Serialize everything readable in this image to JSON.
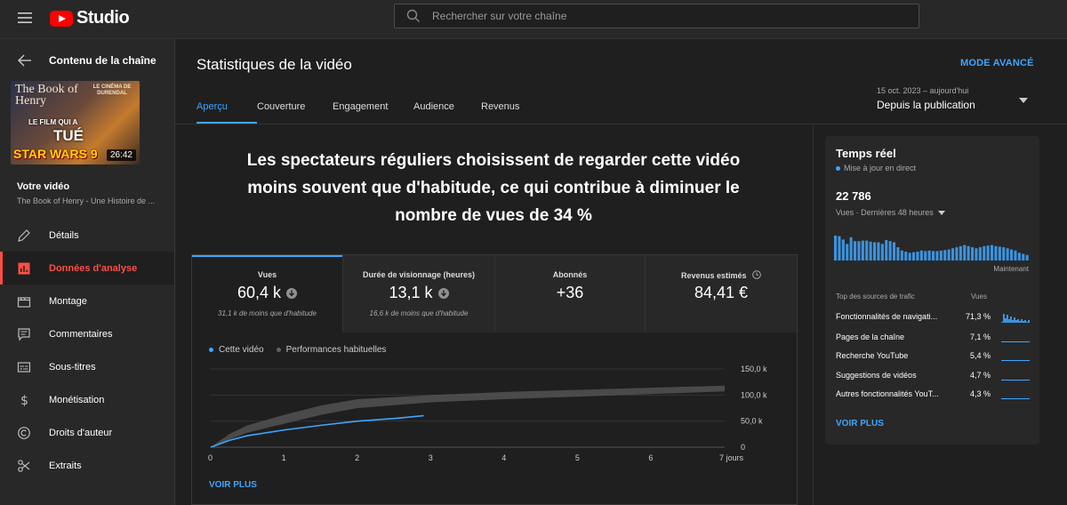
{
  "topbar": {
    "logo_text": "Studio",
    "search_placeholder": "Rechercher sur votre chaîne"
  },
  "sidebar": {
    "back_label": "Contenu de la chaîne",
    "thumbnail": {
      "text_line1": "The Book of Henry",
      "text_line2": "LE CINÉMA DE DURENDAL",
      "text_line3": "LE FILM QUI A",
      "text_line4": "TUÉ",
      "text_line5": "STAR WARS 9",
      "duration": "26:42"
    },
    "your_video_label": "Votre vidéo",
    "video_title": "The Book of Henry - Une Histoire de ...",
    "items": [
      {
        "label": "Détails",
        "icon": "pencil-icon"
      },
      {
        "label": "Données d'analyse",
        "icon": "analytics-icon",
        "active": true
      },
      {
        "label": "Montage",
        "icon": "clapper-icon"
      },
      {
        "label": "Commentaires",
        "icon": "comment-icon"
      },
      {
        "label": "Sous-titres",
        "icon": "subtitles-icon"
      },
      {
        "label": "Monétisation",
        "icon": "dollar-icon"
      },
      {
        "label": "Droits d'auteur",
        "icon": "copyright-icon"
      },
      {
        "label": "Extraits",
        "icon": "scissors-icon"
      }
    ]
  },
  "main": {
    "title": "Statistiques de la vidéo",
    "mode_button": "MODE AVANCÉ",
    "tabs": [
      "Aperçu",
      "Couverture",
      "Engagement",
      "Audience",
      "Revenus"
    ],
    "date_range": "15 oct. 2023 – aujourd'hui",
    "date_selection": "Depuis la publication",
    "headline": "Les spectateurs réguliers choisissent de regarder cette vidéo moins souvent que d'habitude, ce qui contribue à diminuer le nombre de vues de 34 %",
    "metrics": [
      {
        "label": "Vues",
        "value": "60,4 k",
        "sub": "31,1 k de moins que d'habitude",
        "trend": "down"
      },
      {
        "label": "Durée de visionnage (heures)",
        "value": "13,1 k",
        "sub": "16,6 k de moins que d'habitude",
        "trend": "down"
      },
      {
        "label": "Abonnés",
        "value": "+36",
        "sub": ""
      },
      {
        "label": "Revenus estimés",
        "value": "84,41 €",
        "sub": ""
      }
    ],
    "legend": [
      "Cette vidéo",
      "Performances habituelles"
    ],
    "see_more": "VOIR PLUS"
  },
  "chart_data": {
    "type": "line",
    "x_ticks": [
      "0",
      "1",
      "2",
      "3",
      "4",
      "5",
      "6",
      "7 jours"
    ],
    "y_ticks": [
      "0",
      "50,0 k",
      "100,0 k",
      "150,0 k"
    ],
    "ylim": [
      0,
      150000
    ],
    "xlim": [
      0,
      7
    ],
    "series": [
      {
        "name": "Cette vidéo",
        "color": "#3ea6ff",
        "x": [
          0,
          0.25,
          0.5,
          1,
          1.5,
          2,
          2.5,
          2.9
        ],
        "y": [
          0,
          13000,
          22000,
          33000,
          42000,
          50000,
          55000,
          60400
        ]
      },
      {
        "name": "Performances habituelles",
        "color": "#5a5a5a",
        "x": [
          0,
          0.25,
          0.5,
          1,
          1.5,
          2,
          3,
          4,
          5,
          6,
          7
        ],
        "y_low": [
          0,
          15000,
          28000,
          45000,
          62000,
          75000,
          86000,
          92000,
          97000,
          102000,
          107000
        ],
        "y_high": [
          0,
          25000,
          42000,
          62000,
          80000,
          92000,
          100000,
          106000,
          110000,
          114000,
          118000
        ]
      }
    ],
    "grid": true
  },
  "realtime": {
    "title": "Temps réel",
    "live_label": "Mise à jour en direct",
    "count": "22 786",
    "count_label": "Vues · Dernières 48 heures",
    "now_label": "Maintenant",
    "bars": [
      45,
      44,
      38,
      30,
      42,
      35,
      35,
      36,
      36,
      34,
      33,
      33,
      30,
      37,
      35,
      33,
      24,
      18,
      16,
      14,
      15,
      16,
      18,
      17,
      18,
      17,
      17,
      18,
      19,
      20,
      22,
      24,
      26,
      28,
      26,
      24,
      22,
      24,
      26,
      27,
      28,
      26,
      25,
      24,
      22,
      20,
      18,
      14,
      12,
      10
    ],
    "sources_header": "Top des sources de trafic",
    "views_header": "Vues",
    "sources": [
      {
        "name": "Fonctionnalités de navigati...",
        "pct": "71,3 %"
      },
      {
        "name": "Pages de la chaîne",
        "pct": "7,1 %"
      },
      {
        "name": "Recherche YouTube",
        "pct": "5,4 %"
      },
      {
        "name": "Suggestions de vidéos",
        "pct": "4,7 %"
      },
      {
        "name": "Autres fonctionnalités YouT...",
        "pct": "4,3 %"
      }
    ],
    "see_more": "VOIR PLUS"
  }
}
